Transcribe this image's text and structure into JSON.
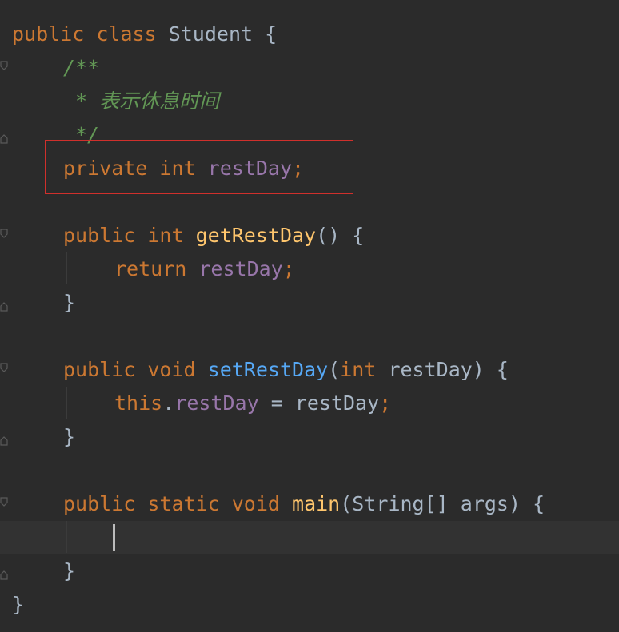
{
  "code": {
    "class_decl": {
      "kw1": "public",
      "kw2": "class",
      "name": "Student",
      "brace": "{"
    },
    "doc_open": "/**",
    "doc_text": "* 表示休息时间",
    "doc_close": "*/",
    "field_decl": {
      "kw1": "private",
      "kw2": "int",
      "name": "restDay",
      "semi": ";"
    },
    "getter_decl": {
      "kw1": "public",
      "kw2": "int",
      "name": "getRestDay",
      "rest": "() {"
    },
    "getter_body": {
      "kw": "return",
      "name": "restDay",
      "semi": ";"
    },
    "close_brace": "}",
    "setter_decl": {
      "kw1": "public",
      "kw2": "void",
      "name": "setRestDay",
      "open": "(",
      "param_kw": "int",
      "param_rest": "restDay) {"
    },
    "setter_body": {
      "kw": "this",
      "dot": ".",
      "field": "restDay",
      "rest": " = restDay",
      "semi": ";"
    },
    "main_decl": {
      "kw1": "public",
      "kw2": "static",
      "kw3": "void",
      "name": "main",
      "rest": "(String[] args) {"
    },
    "class_close": "}"
  },
  "colors": {
    "background": "#2b2b2b",
    "keyword": "#cc7832",
    "field": "#9876aa",
    "method_declaration": "#ffc66d",
    "method_setter": "#56a8f5",
    "doc_comment": "#629755",
    "plain": "#a9b7c6",
    "highlight_box": "#d0302c",
    "current_line": "#323232"
  }
}
